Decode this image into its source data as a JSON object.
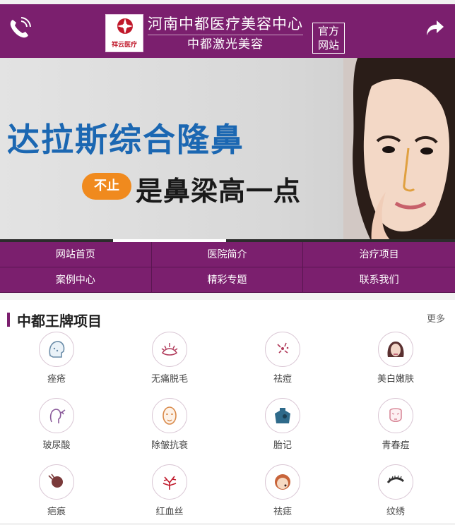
{
  "header": {
    "logo_text": "祥云医疗",
    "title": "河南中都医疗美容中心",
    "subtitle": "中都激光美容",
    "badge_line1": "官方",
    "badge_line2": "网站",
    "phone_icon": "phone-icon",
    "share_icon": "share-arrow-icon",
    "brand_color": "#7b1f6e"
  },
  "banner": {
    "headline": "达拉斯综合隆鼻",
    "badge": "不止",
    "tagline": "是鼻梁高一点",
    "headline_color": "#1b67b2",
    "badge_color": "#f08a1e"
  },
  "nav": {
    "items": [
      {
        "label": "网站首页"
      },
      {
        "label": "医院简介"
      },
      {
        "label": "治疗项目"
      },
      {
        "label": "案例中心"
      },
      {
        "label": "精彩专题"
      },
      {
        "label": "联系我们"
      }
    ]
  },
  "section": {
    "title": "中都王牌项目",
    "more": "更多",
    "items": [
      {
        "label": "痤疮",
        "icon": "acne-face-icon"
      },
      {
        "label": "无痛脱毛",
        "icon": "hair-removal-icon"
      },
      {
        "label": "祛痘",
        "icon": "pimple-icon"
      },
      {
        "label": "美白嫩肤",
        "icon": "woman-face-icon"
      },
      {
        "label": "玻尿酸",
        "icon": "injection-face-icon"
      },
      {
        "label": "除皱抗衰",
        "icon": "wrinkle-face-icon"
      },
      {
        "label": "胎记",
        "icon": "birthmark-body-icon"
      },
      {
        "label": "青春痘",
        "icon": "teen-face-icon"
      },
      {
        "label": "疤痕",
        "icon": "scar-icon"
      },
      {
        "label": "红血丝",
        "icon": "capillary-icon"
      },
      {
        "label": "祛痣",
        "icon": "mole-face-icon"
      },
      {
        "label": "纹绣",
        "icon": "eyebrow-tattoo-icon"
      }
    ]
  }
}
